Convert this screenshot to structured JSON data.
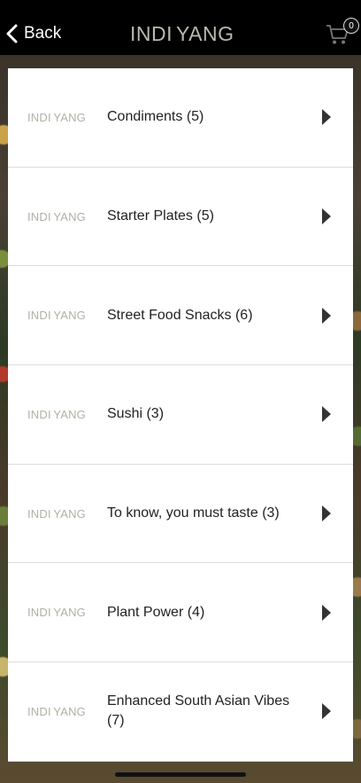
{
  "header": {
    "back_label": "Back",
    "logo_left": "INDI",
    "logo_right": "YANG",
    "cart_count": "0"
  },
  "categories": [
    {
      "logo_left": "INDI",
      "logo_right": "YANG",
      "label": "Condiments  (5)"
    },
    {
      "logo_left": "INDI",
      "logo_right": "YANG",
      "label": "Starter Plates  (5)"
    },
    {
      "logo_left": "INDI",
      "logo_right": "YANG",
      "label": "Street Food Snacks  (6)"
    },
    {
      "logo_left": "INDI",
      "logo_right": "YANG",
      "label": "Sushi  (3)"
    },
    {
      "logo_left": "INDI",
      "logo_right": "YANG",
      "label": "To know, you must taste  (3)"
    },
    {
      "logo_left": "INDI",
      "logo_right": "YANG",
      "label": "Plant Power  (4)"
    },
    {
      "logo_left": "INDI",
      "logo_right": "YANG",
      "label": "Enhanced South Asian Vibes  (7)"
    }
  ]
}
